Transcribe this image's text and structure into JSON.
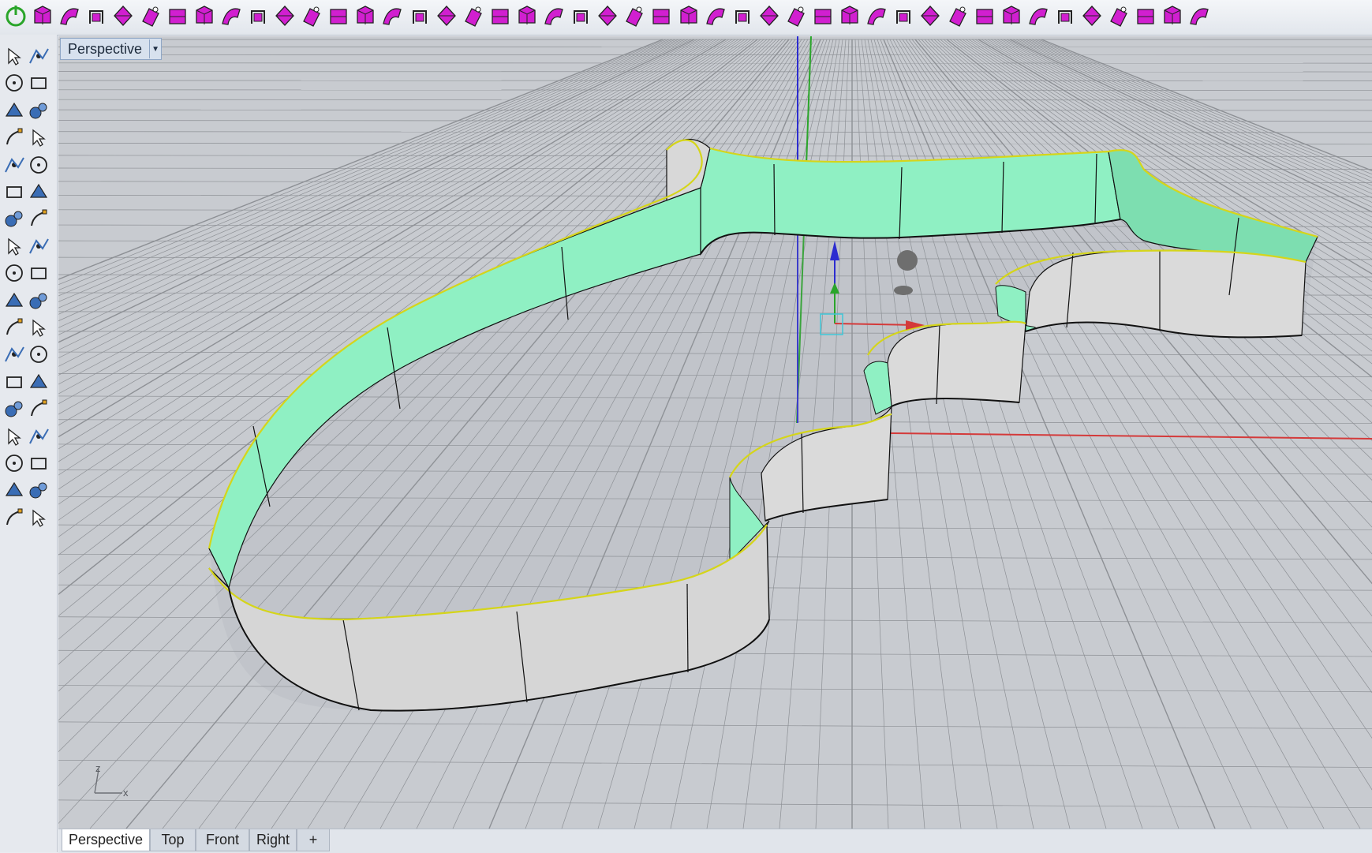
{
  "toolbar": {
    "icons": [
      "power-icon",
      "new-model-icon",
      "box-icon",
      "curve-icon",
      "surface-icon",
      "solid-icon",
      "point-icon",
      "edit-points-icon",
      "rotate-icon",
      "mesh-icon",
      "loft-icon",
      "arch-icon",
      "sweep-icon",
      "extrude-icon",
      "split-icon",
      "trim-icon",
      "wall-icon",
      "gem-icon",
      "blend-icon",
      "dimension-icon",
      "checkbox-icon",
      "grid-icon",
      "layers-icon",
      "delete-icon",
      "copy-icon",
      "array-icon",
      "mirror-icon",
      "bend-icon",
      "ruler-icon",
      "snap-icon",
      "flow-icon",
      "taper-icon",
      "twist-icon",
      "project-icon",
      "scale-icon",
      "orient-icon",
      "star-icon",
      "polygon-icon",
      "text-icon",
      "unroll-icon",
      "patch-icon",
      "network-icon",
      "cross-icon",
      "render-icon",
      "settings-icon"
    ],
    "colors": {
      "accent": "#d11fd0",
      "power": "#2aa52a"
    }
  },
  "sidebar": {
    "icons": [
      "select-arrow-icon",
      "point-icon",
      "polyline-icon",
      "curve-icon",
      "circle-icon",
      "ellipse-icon",
      "arc-icon",
      "rectangle-icon",
      "polygon-icon",
      "blend-curve-icon",
      "surface-icon",
      "patch-icon",
      "box-icon",
      "sphere-icon",
      "cylinder-icon",
      "plane-icon",
      "gumball-icon",
      "lightning-icon",
      "project-icon",
      "split-icon",
      "boolean-icon",
      "group-icon",
      "fillet-icon",
      "offset-icon",
      "text-icon",
      "scale-icon",
      "array-icon",
      "move-icon",
      "solid-box-icon",
      "dimension-icon",
      "grid-array-icon",
      "distribute-icon",
      "flow-icon",
      "check-icon",
      "sphere-render-icon",
      "paint-icon"
    ]
  },
  "viewport": {
    "title": "Perspective",
    "axis_labels": {
      "z": "z",
      "x": "x"
    }
  },
  "tabs": [
    {
      "label": "Perspective",
      "active": true
    },
    {
      "label": "Top"
    },
    {
      "label": "Front"
    },
    {
      "label": "Right"
    },
    {
      "label": "+"
    }
  ],
  "colors": {
    "inner_surface": "#8ff0c3",
    "outer_surface": "#dcdcdc",
    "edge_highlight": "#d5d51a",
    "grid_line": "#8d9095",
    "x_axis": "#d43a3a",
    "y_axis": "#2aa52a",
    "z_axis": "#2c2cd0"
  }
}
